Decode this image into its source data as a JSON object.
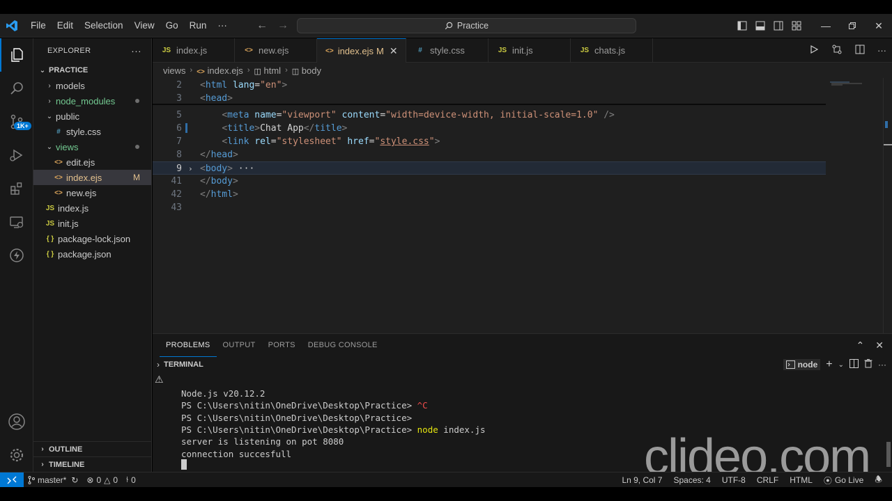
{
  "titlebar": {
    "menu": [
      "File",
      "Edit",
      "Selection",
      "View",
      "Go",
      "Run",
      "···"
    ],
    "search_text": "Practice"
  },
  "activity": {
    "badge": "1K+"
  },
  "sidebar": {
    "title": "EXPLORER",
    "more": "···",
    "folder": "PRACTICE",
    "tree": [
      {
        "label": "models",
        "kind": "folder",
        "open": false,
        "indent": 1
      },
      {
        "label": "node_modules",
        "kind": "folder",
        "open": false,
        "indent": 1,
        "dot": true,
        "color": "#73c991"
      },
      {
        "label": "public",
        "kind": "folder",
        "open": true,
        "indent": 1
      },
      {
        "label": "style.css",
        "kind": "css",
        "indent": 2
      },
      {
        "label": "views",
        "kind": "folder",
        "open": true,
        "indent": 1,
        "dot": true,
        "color": "#73c991"
      },
      {
        "label": "edit.ejs",
        "kind": "ejs",
        "indent": 2
      },
      {
        "label": "index.ejs",
        "kind": "ejs",
        "indent": 2,
        "mod": "M",
        "selected": true,
        "color": "#e2c08d"
      },
      {
        "label": "new.ejs",
        "kind": "ejs",
        "indent": 2
      },
      {
        "label": "index.js",
        "kind": "js",
        "indent": 1
      },
      {
        "label": "init.js",
        "kind": "js",
        "indent": 1
      },
      {
        "label": "package-lock.json",
        "kind": "json",
        "indent": 1
      },
      {
        "label": "package.json",
        "kind": "json",
        "indent": 1
      }
    ],
    "outline": "OUTLINE",
    "timeline": "TIMELINE"
  },
  "tabs": [
    {
      "label": "index.js",
      "kind": "js"
    },
    {
      "label": "new.ejs",
      "kind": "ejs"
    },
    {
      "label": "index.ejs",
      "kind": "ejs",
      "active": true,
      "mod": "M"
    },
    {
      "label": "style.css",
      "kind": "css"
    },
    {
      "label": "init.js",
      "kind": "js"
    },
    {
      "label": "chats.js",
      "kind": "js"
    }
  ],
  "breadcrumb": {
    "folder": "views",
    "file": "index.ejs",
    "node1": "html",
    "node2": "body"
  },
  "code": [
    {
      "num": "2",
      "html": "<span class='t-bracket'>&lt;</span><span class='t-tag'>html</span> <span class='t-attr'>lang</span><span class='t-text'>=</span><span class='t-str'>\"en\"</span><span class='t-bracket'>&gt;</span>"
    },
    {
      "num": "3",
      "html": "<span class='t-bracket'>&lt;</span><span class='t-tag'>head</span><span class='t-bracket'>&gt;</span>"
    },
    {
      "num": "5",
      "html": "    <span class='t-bracket'>&lt;</span><span class='t-tag'>meta</span> <span class='t-attr'>name</span><span class='t-text'>=</span><span class='t-str'>\"viewport\"</span> <span class='t-attr'>content</span><span class='t-text'>=</span><span class='t-str'>\"width=device-width, initial-scale=1.0\"</span> <span class='t-bracket'>/&gt;</span>"
    },
    {
      "num": "6",
      "html": "    <span class='t-bracket'>&lt;</span><span class='t-tag'>title</span><span class='t-bracket'>&gt;</span><span class='t-text'>Chat App</span><span class='t-bracket'>&lt;/</span><span class='t-tag'>title</span><span class='t-bracket'>&gt;</span>",
      "modified": true
    },
    {
      "num": "7",
      "html": "    <span class='t-bracket'>&lt;</span><span class='t-tag'>link</span> <span class='t-attr'>rel</span><span class='t-text'>=</span><span class='t-str'>\"stylesheet\"</span> <span class='t-attr'>href</span><span class='t-text'>=</span><span class='t-str'>\"<u>style.css</u>\"</span><span class='t-bracket'>&gt;</span>"
    },
    {
      "num": "8",
      "html": "<span class='t-bracket'>&lt;/</span><span class='t-tag'>head</span><span class='t-bracket'>&gt;</span>"
    },
    {
      "num": "9",
      "html": "<span class='t-bracket'>&lt;</span><span class='t-tag'>body</span><span class='t-bracket'>&gt;</span><span class='t-text'> ···</span>",
      "current": true,
      "folded": true
    },
    {
      "num": "41",
      "html": "<span class='t-bracket'>&lt;/</span><span class='t-tag'>body</span><span class='t-bracket'>&gt;</span>"
    },
    {
      "num": "42",
      "html": "<span class='t-bracket'>&lt;/</span><span class='t-tag'>html</span><span class='t-bracket'>&gt;</span>"
    },
    {
      "num": "43",
      "html": ""
    }
  ],
  "panel": {
    "tabs": [
      "PROBLEMS",
      "OUTPUT",
      "PORTS",
      "DEBUG CONSOLE"
    ],
    "active_tab": "PROBLEMS",
    "terminal_title": "TERMINAL",
    "shell": "node",
    "lines": [
      {
        "text": "Node.js v20.12.2"
      },
      {
        "prompt": "PS C:\\Users\\nitin\\OneDrive\\Desktop\\Practice> ",
        "cmd": "^C",
        "cmd_class": "t-red"
      },
      {
        "prompt": "PS C:\\Users\\nitin\\OneDrive\\Desktop\\Practice>",
        "cmd": ""
      },
      {
        "prompt": "PS C:\\Users\\nitin\\OneDrive\\Desktop\\Practice> ",
        "cmd": "node",
        "rest": " index.js",
        "cmd_class": "t-cmd"
      },
      {
        "text": "server is listening on pot 8080"
      },
      {
        "text": "connection succesfull"
      }
    ],
    "watermark": "clideo.com"
  },
  "statusbar": {
    "branch": "master*",
    "errors": "0",
    "warnings": "0",
    "ports": "0",
    "position": "Ln 9, Col 7",
    "spaces": "Spaces: 4",
    "encoding": "UTF-8",
    "eol": "CRLF",
    "language": "HTML",
    "golive": "Go Live"
  }
}
